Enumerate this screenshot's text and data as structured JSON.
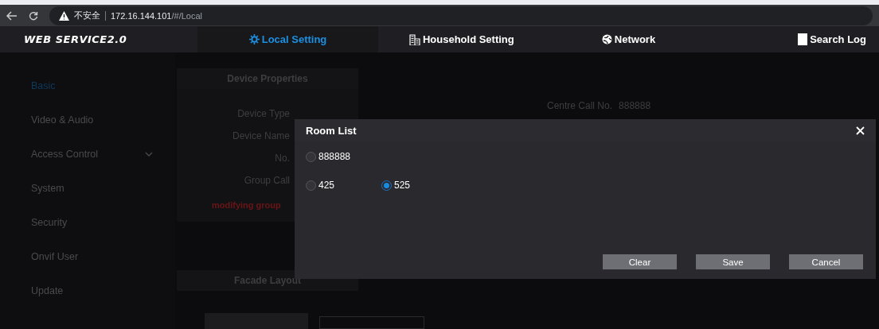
{
  "browser": {
    "security_label": "不安全",
    "url_host": "172.16.144.101",
    "url_path": "/#/Local"
  },
  "header": {
    "logo": "WEB SERVICE2.0",
    "tabs": [
      {
        "label": "Local Setting",
        "selected": true
      },
      {
        "label": "Household Setting",
        "selected": false
      },
      {
        "label": "Network",
        "selected": false
      },
      {
        "label": "Search Log",
        "selected": false
      }
    ]
  },
  "sidebar": {
    "items": [
      {
        "label": "Basic",
        "selected": true,
        "kind": "item"
      },
      {
        "label": "Video & Audio",
        "selected": false,
        "kind": "item"
      },
      {
        "label": "Access Control",
        "selected": false,
        "kind": "group"
      },
      {
        "label": "System",
        "selected": false,
        "kind": "item"
      },
      {
        "label": "Security",
        "selected": false,
        "kind": "item"
      },
      {
        "label": "Onvif User",
        "selected": false,
        "kind": "item"
      },
      {
        "label": "Update",
        "selected": false,
        "kind": "item"
      }
    ]
  },
  "device_properties": {
    "title": "Device Properties",
    "fields": [
      "Device Type",
      "Device Name",
      "No.",
      "Group Call"
    ],
    "warning": "modifying group",
    "centre_call": {
      "label": "Centre Call No.",
      "value": "888888"
    }
  },
  "facade_layout": {
    "title": "Facade Layout"
  },
  "dialog": {
    "title": "Room List",
    "rows": [
      [
        {
          "label": "888888",
          "selected": false
        }
      ],
      [
        {
          "label": "425",
          "selected": false
        },
        {
          "label": "525",
          "selected": true
        }
      ]
    ],
    "buttons": [
      "Clear",
      "Save",
      "Cancel"
    ]
  }
}
